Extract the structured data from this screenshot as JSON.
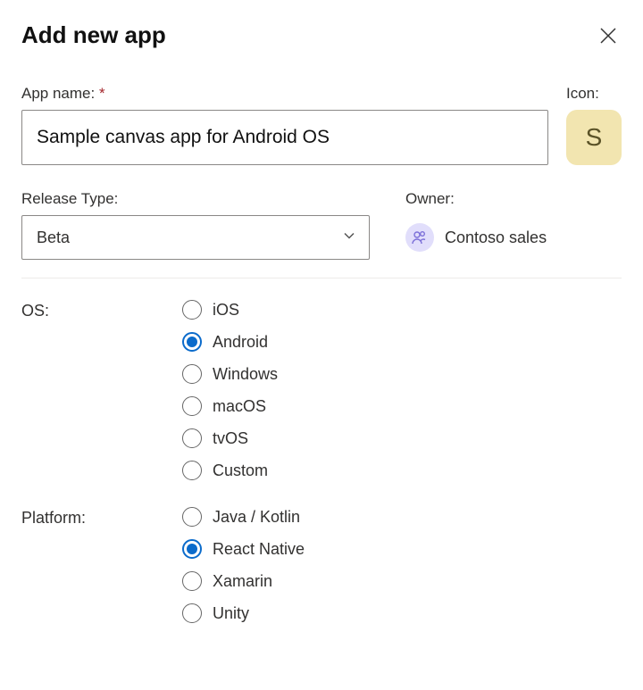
{
  "header": {
    "title": "Add new app"
  },
  "fields": {
    "appName": {
      "label": "App name:",
      "required": "*",
      "value": "Sample canvas app for Android OS"
    },
    "icon": {
      "label": "Icon:",
      "letter": "S"
    },
    "releaseType": {
      "label": "Release Type:",
      "value": "Beta"
    },
    "owner": {
      "label": "Owner:",
      "value": "Contoso sales"
    }
  },
  "os": {
    "label": "OS:",
    "selected": "Android",
    "options": [
      "iOS",
      "Android",
      "Windows",
      "macOS",
      "tvOS",
      "Custom"
    ]
  },
  "platform": {
    "label": "Platform:",
    "selected": "React Native",
    "options": [
      "Java / Kotlin",
      "React Native",
      "Xamarin",
      "Unity"
    ]
  }
}
